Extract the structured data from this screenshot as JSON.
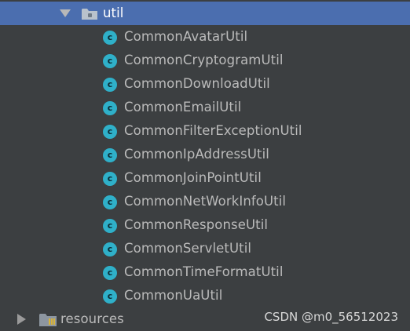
{
  "tree": {
    "util_folder": {
      "label": "util",
      "icon": "package-folder-icon",
      "expanded": true,
      "selected": true
    },
    "classes": [
      {
        "label": "CommonAvatarUtil",
        "icon_letter": "c"
      },
      {
        "label": "CommonCryptogramUtil",
        "icon_letter": "c"
      },
      {
        "label": "CommonDownloadUtil",
        "icon_letter": "c"
      },
      {
        "label": "CommonEmailUtil",
        "icon_letter": "c"
      },
      {
        "label": "CommonFilterExceptionUtil",
        "icon_letter": "c"
      },
      {
        "label": "CommonIpAddressUtil",
        "icon_letter": "c"
      },
      {
        "label": "CommonJoinPointUtil",
        "icon_letter": "c"
      },
      {
        "label": "CommonNetWorkInfoUtil",
        "icon_letter": "c"
      },
      {
        "label": "CommonResponseUtil",
        "icon_letter": "c"
      },
      {
        "label": "CommonServletUtil",
        "icon_letter": "c"
      },
      {
        "label": "CommonTimeFormatUtil",
        "icon_letter": "c"
      },
      {
        "label": "CommonUaUtil",
        "icon_letter": "c"
      }
    ],
    "resources_folder": {
      "label": "resources",
      "icon": "resources-folder-icon",
      "expanded": false
    }
  },
  "watermark": "CSDN @m0_56512023",
  "colors": {
    "background": "#3c3f41",
    "selection": "#4b6eaf",
    "text": "#bbbbbb",
    "class_icon": "#2fb0c9"
  }
}
